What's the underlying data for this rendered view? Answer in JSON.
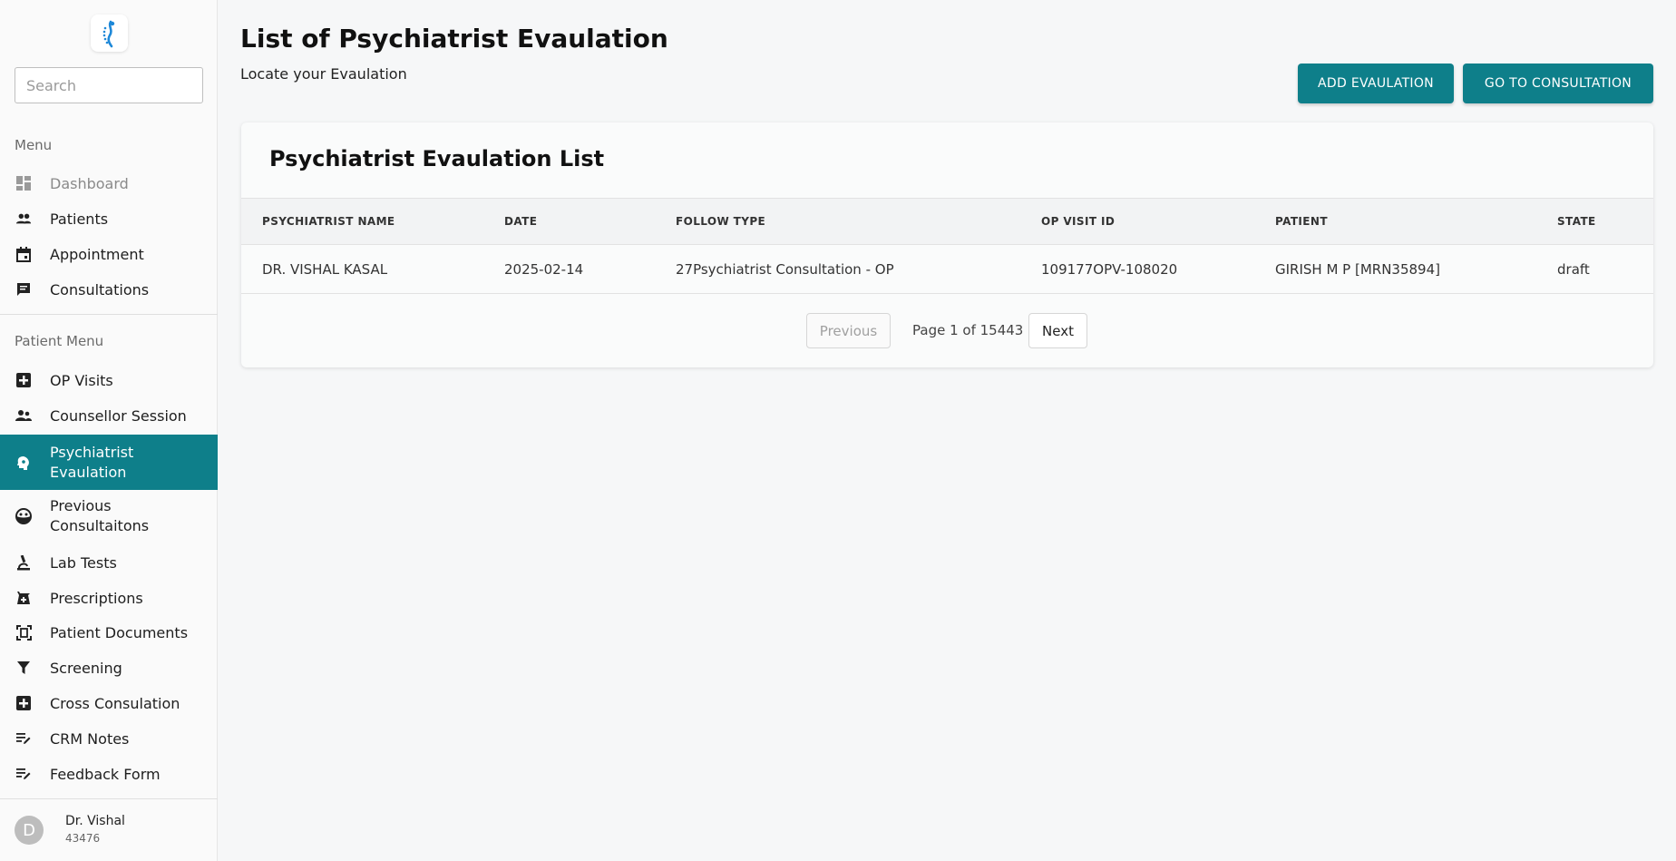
{
  "sidebar": {
    "search_placeholder": "Search",
    "menu_label": "Menu",
    "menu_items": [
      {
        "label": "Dashboard",
        "icon": "dashboard-icon"
      },
      {
        "label": "Patients",
        "icon": "people-icon"
      },
      {
        "label": "Appointment",
        "icon": "calendar-icon"
      },
      {
        "label": "Consultations",
        "icon": "chat-icon"
      }
    ],
    "patient_menu_label": "Patient Menu",
    "patient_items": [
      {
        "label": "OP Visits",
        "icon": "medical-plus-icon"
      },
      {
        "label": "Counsellor Session",
        "icon": "group-icon"
      },
      {
        "label": "Psychiatrist",
        "label2": "Evaulation",
        "icon": "brain-icon"
      },
      {
        "label": "Previous",
        "label2": "Consultaitons",
        "icon": "face-icon"
      },
      {
        "label": "Lab Tests",
        "icon": "microscope-icon"
      },
      {
        "label": "Prescriptions",
        "icon": "pharmacy-icon"
      },
      {
        "label": "Patient Documents",
        "icon": "document-scan-icon"
      },
      {
        "label": "Screening",
        "icon": "filter-icon"
      },
      {
        "label": "Cross Consulation",
        "icon": "medical-plus-icon"
      },
      {
        "label": "CRM Notes",
        "icon": "edit-note-icon"
      },
      {
        "label": "Feedback Form",
        "icon": "edit-note-icon"
      }
    ],
    "user": {
      "initial": "D",
      "name": "Dr. Vishal",
      "id": "43476"
    }
  },
  "header": {
    "title": "List of Psychiatrist Evaulation",
    "subtitle": "Locate your Evaulation",
    "add_button": "ADD EVAULATION",
    "consult_button": "GO TO CONSULTATION"
  },
  "card": {
    "title": "Psychiatrist Evaulation List",
    "columns": [
      "PSYCHIATRIST NAME",
      "DATE",
      "FOLLOW TYPE",
      "OP VISIT ID",
      "PATIENT",
      "STATE"
    ],
    "rows": [
      [
        "DR. VISHAL KASAL",
        "2025-02-14",
        "27Psychiatrist Consultation - OP",
        "109177OPV-108020",
        "GIRISH M P [MRN35894]",
        "draft"
      ]
    ]
  },
  "pagination": {
    "previous": "Previous",
    "info": "Page 1 of 15443",
    "next": "Next"
  },
  "colors": {
    "accent": "#0e7f8a"
  }
}
